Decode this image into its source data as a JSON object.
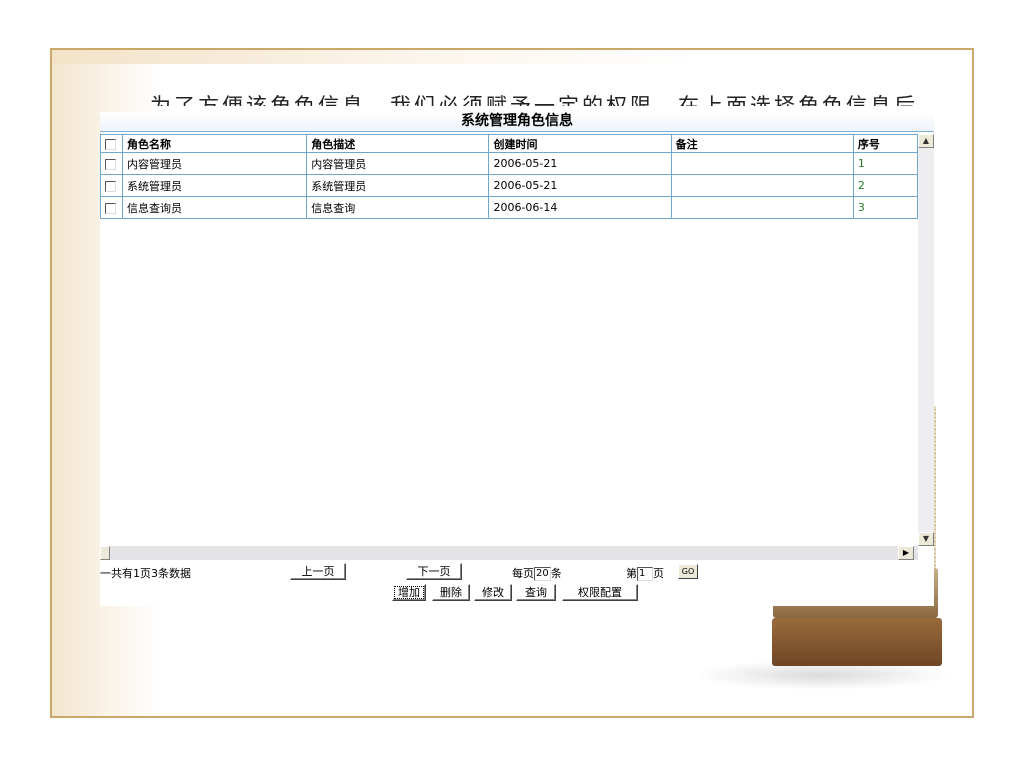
{
  "caption_text": "为了方便该角色信息，我们必须赋予一定的权限，在上面选择角色信息后，点击下",
  "app": {
    "title": "系统管理角色信息",
    "columns": [
      "角色名称",
      "角色描述",
      "创建时间",
      "备注",
      "序号"
    ],
    "rows": [
      {
        "name": "内容管理员",
        "desc": "内容管理员",
        "created": "2006-05-21",
        "note": "",
        "seq": "1"
      },
      {
        "name": "系统管理员",
        "desc": "系统管理员",
        "created": "2006-05-21",
        "note": "",
        "seq": "2"
      },
      {
        "name": "信息查询员",
        "desc": "信息查询",
        "created": "2006-06-14",
        "note": "",
        "seq": "3"
      }
    ]
  },
  "pager": {
    "total_text": "一共有1页3条数据",
    "prev_label": "上一页",
    "next_label": "下一页",
    "per_page_prefix": "每页",
    "per_page_value": "20",
    "per_page_suffix": "条",
    "page_prefix": "第",
    "page_value": "1",
    "page_suffix": "页",
    "go_label": "GO"
  },
  "actions": {
    "add_label": "增加",
    "delete_label": "删除",
    "edit_label": "修改",
    "query_label": "查询",
    "permission_label": "权限配置"
  },
  "colors": {
    "frame": "#c9a86a",
    "grid_border": "#6fa8cc",
    "seq_text": "#2a7a2a"
  }
}
